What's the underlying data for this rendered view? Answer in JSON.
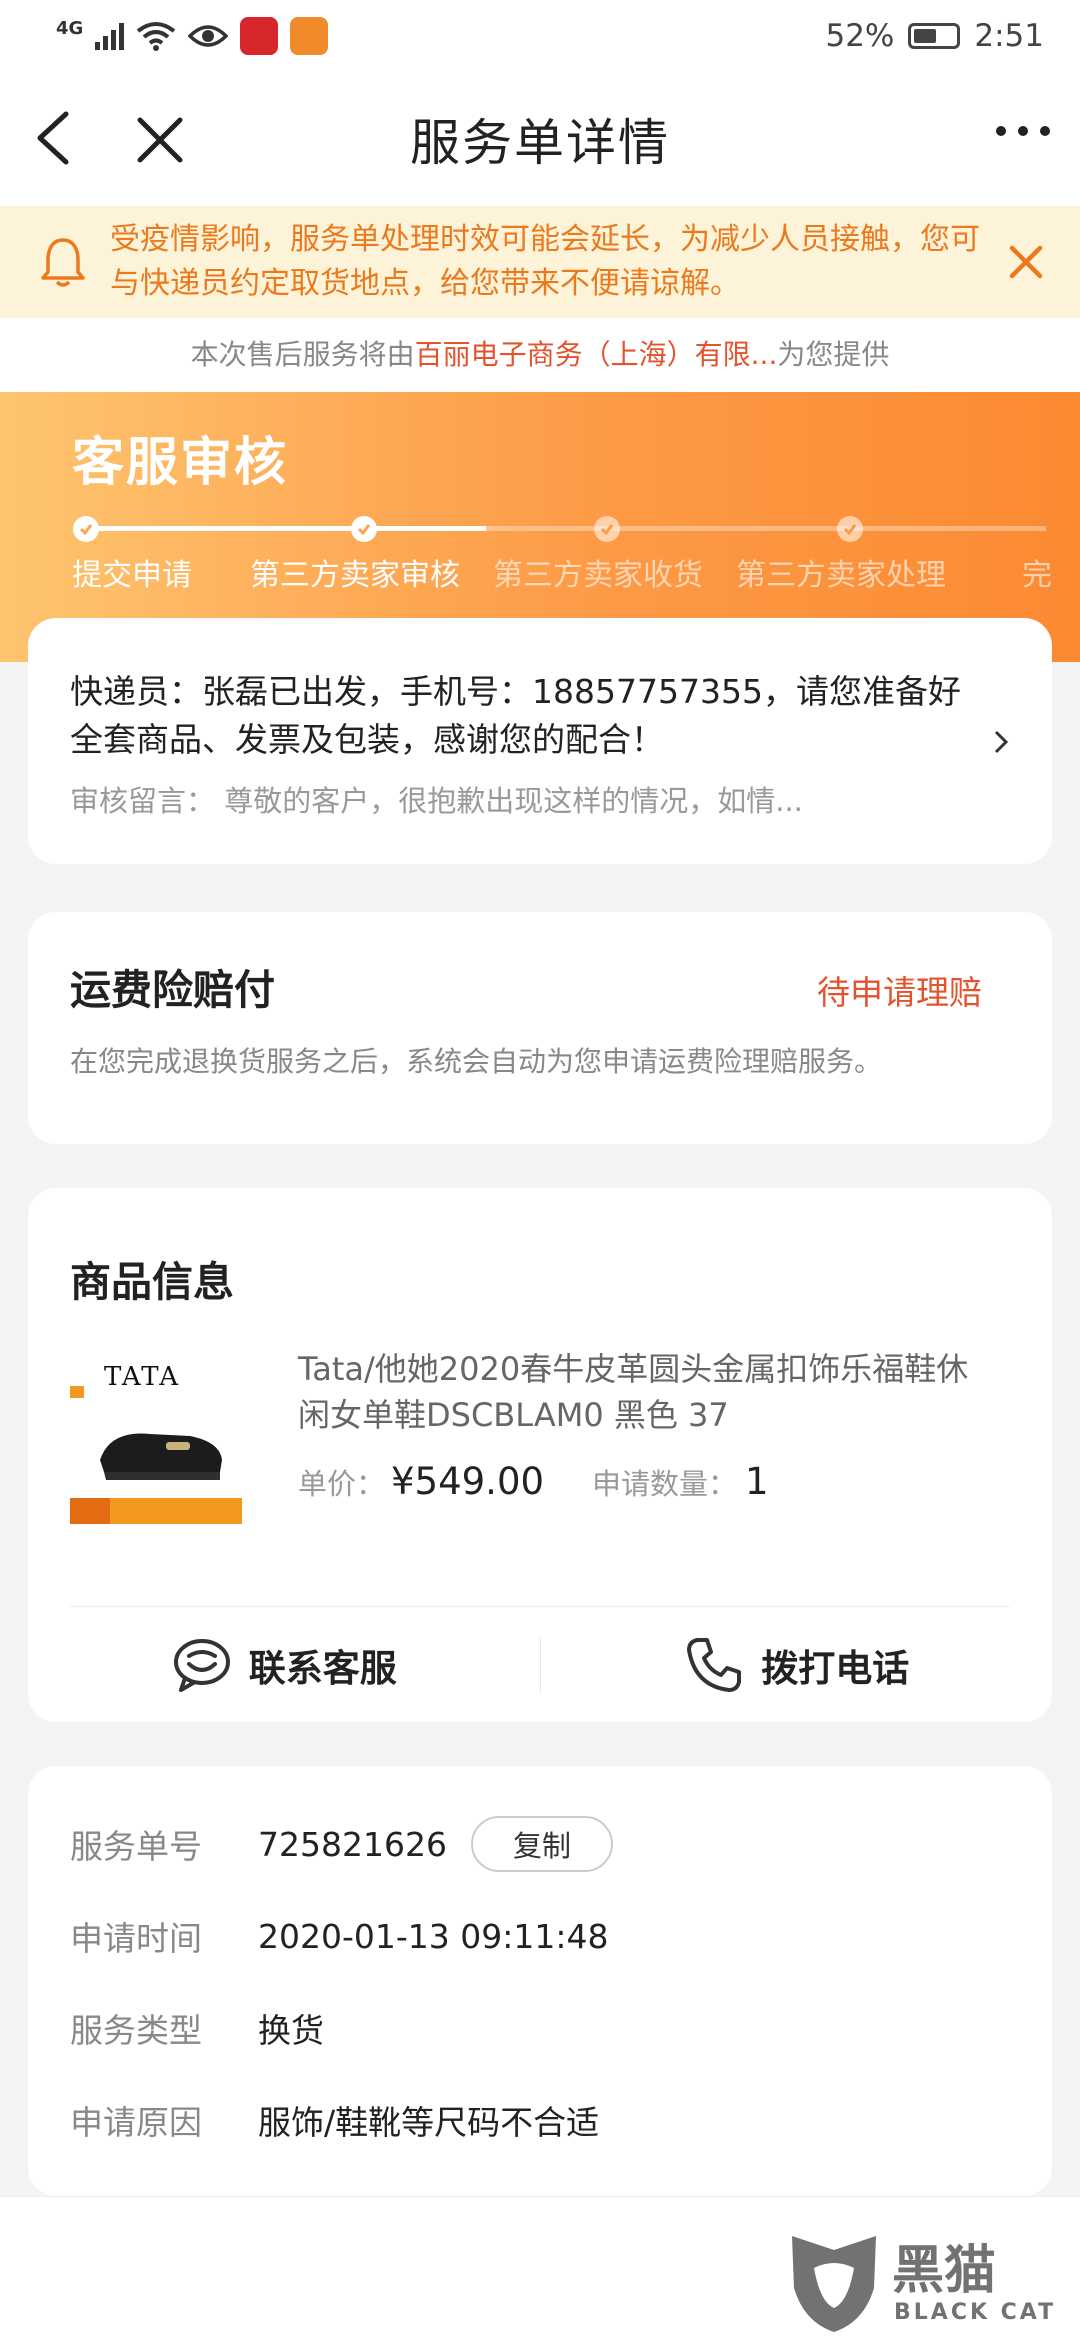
{
  "status_bar": {
    "network": "4G",
    "battery": "52%",
    "time": "2:51"
  },
  "nav": {
    "title": "服务单详情"
  },
  "notice": {
    "text": "受疫情影响，服务单处理时效可能会延长，为减少人员接触，您可与快递员约定取货地点，给您带来不便请谅解。"
  },
  "provider": {
    "prefix": "本次售后服务将由",
    "name": "百丽电子商务（上海）有限...",
    "suffix": "为您提供"
  },
  "progress": {
    "title": "客服审核",
    "steps": [
      {
        "label": "提交申请",
        "status": "done"
      },
      {
        "label": "第三方卖家审核",
        "status": "done"
      },
      {
        "label": "第三方卖家收货",
        "status": "pending"
      },
      {
        "label": "第三方卖家处理",
        "status": "pending"
      },
      {
        "label": "完",
        "status": "pending"
      }
    ]
  },
  "courier": {
    "text": "快递员：张磊已出发，手机号：18857757355，请您准备好全套商品、发票及包装，感谢您的配合！",
    "review": "审核留言： 尊敬的客户，很抱歉出现这样的情况，如情..."
  },
  "insurance": {
    "title": "运费险赔付",
    "status": "待申请理赔",
    "desc": "在您完成退换货服务之后，系统会自动为您申请运费险理赔服务。"
  },
  "product": {
    "section_title": "商品信息",
    "brand": "TATA",
    "name": "Tata/他她2020春牛皮革圆头金属扣饰乐福鞋休闲女单鞋DSCBLAM0 黑色 37",
    "price_label": "单价：",
    "price": "¥549.00",
    "qty_label": "申请数量：",
    "qty": "1",
    "contact_label": "联系客服",
    "call_label": "拨打电话"
  },
  "service_info": {
    "order_no_label": "服务单号",
    "order_no": "725821626",
    "copy_label": "复制",
    "time_label": "申请时间",
    "time": "2020-01-13 09:11:48",
    "type_label": "服务类型",
    "type": "换货",
    "reason_label": "申请原因",
    "reason": "服饰/鞋靴等尺码不合适"
  },
  "watermark": {
    "text": "黑猫",
    "sub": "BLACK CAT"
  },
  "colors": {
    "accent": "#e5522d",
    "notice_text": "#ec7a1c",
    "notice_bg": "#fdf3d9",
    "progress_gradient_start": "#fec46e",
    "progress_gradient_end": "#fb8a32"
  }
}
